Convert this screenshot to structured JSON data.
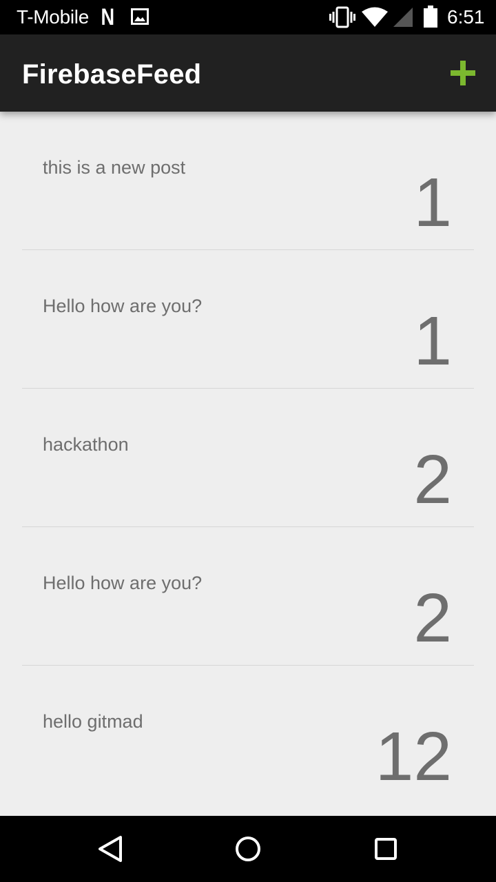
{
  "status_bar": {
    "carrier": "T-Mobile",
    "notification_n": "N",
    "time": "6:51",
    "icons": [
      "n-notification-icon",
      "image-notification-icon",
      "vibrate-icon",
      "wifi-icon",
      "cell-signal-icon",
      "battery-icon"
    ]
  },
  "app_bar": {
    "title": "FirebaseFeed",
    "add_icon": "plus-icon",
    "accent_color": "#7cb82f"
  },
  "feed": {
    "items": [
      {
        "text": "this is a new post",
        "count": "1"
      },
      {
        "text": "Hello how are you?",
        "count": "1"
      },
      {
        "text": "hackathon",
        "count": "2"
      },
      {
        "text": "Hello how are you?",
        "count": "2"
      },
      {
        "text": "hello gitmad",
        "count": "12"
      }
    ]
  },
  "nav_bar": {
    "icons": [
      "back-icon",
      "home-icon",
      "recents-icon"
    ]
  }
}
